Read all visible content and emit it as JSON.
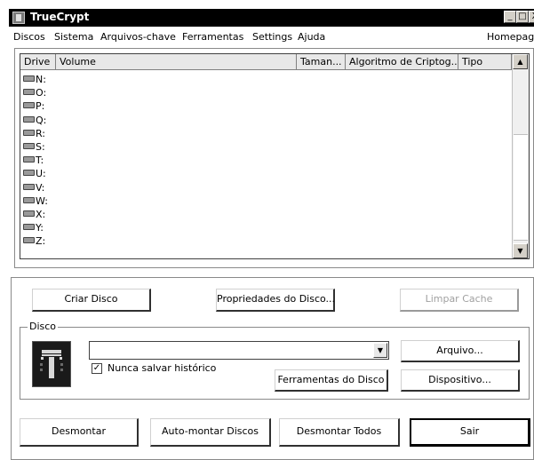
{
  "window": {
    "title": "TrueCrypt",
    "controls": {
      "minimize": "_",
      "maximize": "□",
      "close": "X"
    }
  },
  "menubar": {
    "items": [
      "Discos",
      "Sistema",
      "Arquivos-chave",
      "Ferramentas",
      "Settings",
      "Ajuda"
    ],
    "homepage": "Homepage"
  },
  "volume_list": {
    "columns": [
      "Drive",
      "Volume",
      "Taman...",
      "Algoritmo de Criptog...",
      "Tipo"
    ],
    "rows": [
      {
        "drive": "N:"
      },
      {
        "drive": "O:"
      },
      {
        "drive": "P:"
      },
      {
        "drive": "Q:"
      },
      {
        "drive": "R:"
      },
      {
        "drive": "S:"
      },
      {
        "drive": "T:"
      },
      {
        "drive": "U:"
      },
      {
        "drive": "V:"
      },
      {
        "drive": "W:"
      },
      {
        "drive": "X:"
      },
      {
        "drive": "Y:"
      },
      {
        "drive": "Z:"
      }
    ],
    "scroll_up_icon": "scroll-up-arrow-icon",
    "scroll_down_icon": "scroll-down-arrow-icon"
  },
  "actions": {
    "create_volume": "Criar Disco",
    "volume_properties": "Propriedades do Disco...",
    "wipe_cache": "Limpar Cache"
  },
  "volume_group": {
    "label": "Disco",
    "path_value": "",
    "never_save_history": {
      "label": "Nunca salvar histórico",
      "checked": true,
      "mark": "✓"
    },
    "select_file": "Arquivo...",
    "volume_tools": "Ferramentas do Disco",
    "select_device": "Dispositivo..."
  },
  "bottom": {
    "dismount": "Desmontar",
    "auto_mount": "Auto-montar Discos",
    "dismount_all": "Desmontar Todos",
    "exit": "Sair"
  }
}
